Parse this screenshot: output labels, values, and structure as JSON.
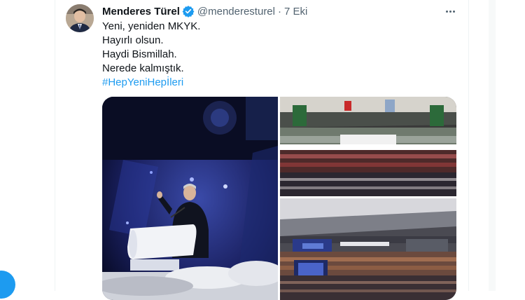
{
  "tweet": {
    "author_name": "Menderes Türel",
    "handle": "@menderesturel",
    "separator": "·",
    "date": "7 Eki",
    "lines": [
      "Yeni, yeniden MKYK.",
      "Hayırlı olsun.",
      "Haydi Bismillah.",
      "Nerede kalmıştık."
    ],
    "hashtag": "#HepYeniHepİleri"
  },
  "media": {
    "photos": [
      "speaker-on-stage-photo",
      "crowd-in-arena-photo",
      "arena-wide-view-photo"
    ]
  },
  "colors": {
    "accent": "#1d9bf0",
    "text_primary": "#0f1419",
    "text_secondary": "#536471"
  },
  "icons": {
    "verified": "verified-badge-icon",
    "more": "more-options-icon"
  }
}
